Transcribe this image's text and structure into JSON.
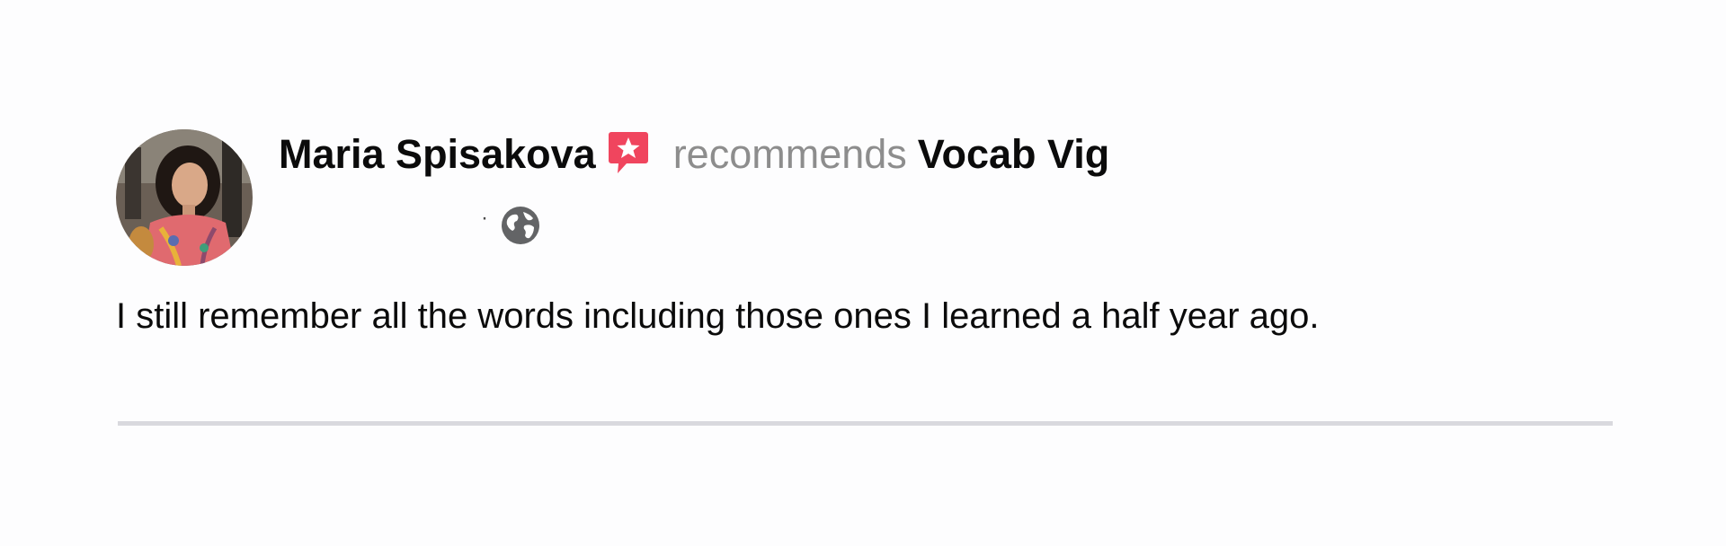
{
  "post": {
    "author_name": "Maria Spisakova",
    "badge_icon": "recommendation-star-icon",
    "action_text": "recommends",
    "page_name": "Vocab Vig",
    "timestamp": "",
    "separator": "·",
    "audience_icon": "globe-icon",
    "body": "I still remember all the words including those ones I learned a half year ago."
  },
  "colors": {
    "name_text": "#0b0b0b",
    "action_text": "#8d8d8d",
    "badge": "#f0455e",
    "globe": "#636466",
    "divider": "#d9d9de",
    "background": "#fdfdfe"
  }
}
